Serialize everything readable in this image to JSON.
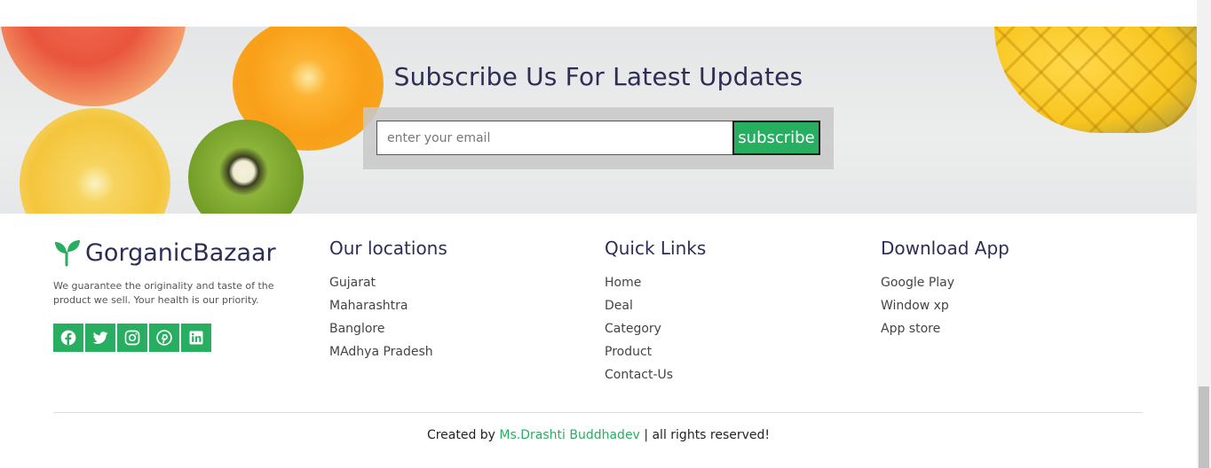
{
  "banner": {
    "title": "Subscribe Us For Latest Updates",
    "email_placeholder": "enter your email",
    "email_value": "",
    "subscribe_label": "subscribe"
  },
  "brand": {
    "name": "GorganicBazaar",
    "description": "We guarantee the originality and taste of the product we sell. Your health is our priority.",
    "icon": "leaf-sprout-icon"
  },
  "socials": [
    {
      "icon": "facebook-icon"
    },
    {
      "icon": "twitter-icon"
    },
    {
      "icon": "instagram-icon"
    },
    {
      "icon": "pinterest-icon"
    },
    {
      "icon": "linkedin-icon"
    }
  ],
  "locations": {
    "heading": "Our locations",
    "items": [
      "Gujarat",
      "Maharashtra",
      "Banglore",
      "MAdhya Pradesh"
    ]
  },
  "quick_links": {
    "heading": "Quick Links",
    "items": [
      "Home",
      "Deal",
      "Category",
      "Product",
      "Contact-Us"
    ]
  },
  "download_app": {
    "heading": "Download App",
    "items": [
      "Google Play",
      "Window xp",
      "App store"
    ]
  },
  "credits": {
    "prefix": "Created by",
    "author": "Ms.Drashti Buddhadev",
    "suffix": "| all rights reserved!"
  },
  "colors": {
    "accent": "#27ae60",
    "heading": "#2d2d55"
  }
}
